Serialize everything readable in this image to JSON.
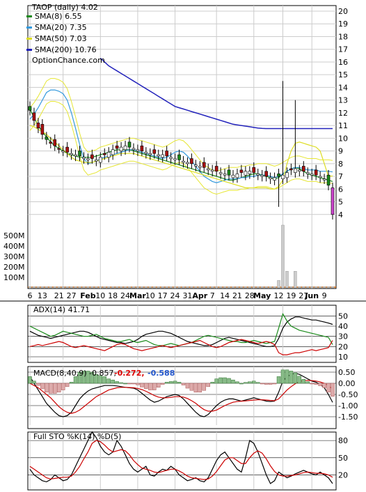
{
  "chart_data": [
    {
      "panel": "price",
      "type": "candlestick",
      "title": "TAOP (daily) 4.02",
      "watermark": "OptionChance.com",
      "legend": [
        {
          "label": "SMA(8) 6.55",
          "color": "#1a8a1a"
        },
        {
          "label": "SMA(20) 7.35",
          "color": "#3399dd"
        },
        {
          "label": "SMA(50) 7.03",
          "color": "#dddd22"
        },
        {
          "label": "SMA(200) 10.76",
          "color": "#2222bb"
        }
      ],
      "legend_position": "top-left",
      "x_tick_labels": [
        "6",
        "13",
        "21",
        "27",
        "Feb",
        "10",
        "18",
        "24",
        "Mar",
        "10",
        "17",
        "24",
        "31",
        "Apr",
        "7",
        "14",
        "21",
        "28",
        "May",
        "12",
        "19",
        "27",
        "Jun",
        "9"
      ],
      "ylim": [
        3,
        20
      ],
      "y_ticks": [
        4,
        5,
        6,
        7,
        8,
        9,
        10,
        11,
        12,
        13,
        14,
        15,
        16,
        17,
        18,
        19,
        20
      ],
      "volume_ticks": [
        "100M",
        "200M",
        "300M",
        "400M",
        "500M"
      ],
      "grid": true,
      "close": [
        12.2,
        11.4,
        10.8,
        10.3,
        9.9,
        9.6,
        9.4,
        9.2,
        9.0,
        8.9,
        8.8,
        8.7,
        8.6,
        8.5,
        8.4,
        8.4,
        8.3,
        8.5,
        8.7,
        8.9,
        9.1,
        9.2,
        9.3,
        9.4,
        9.3,
        9.2,
        9.1,
        9.0,
        8.9,
        8.8,
        8.8,
        8.7,
        8.7,
        8.6,
        8.5,
        8.4,
        8.3,
        8.2,
        8.1,
        8.0,
        7.9,
        7.8,
        7.7,
        7.6,
        7.5,
        7.4,
        7.3,
        7.2,
        7.1,
        7.1,
        7.2,
        7.3,
        7.4,
        7.4,
        7.3,
        7.2,
        7.1,
        7.0,
        6.9,
        6.9,
        7.0,
        7.1,
        7.3,
        7.5,
        7.6,
        7.5,
        7.4,
        7.3,
        7.2,
        7.1,
        7.0,
        6.8,
        6.3,
        4.0
      ],
      "sma": {
        "SMA(8)": [
          12.3,
          11.6,
          11.0,
          10.5,
          10.1,
          9.7,
          9.4,
          9.2,
          9.0,
          8.8,
          8.7,
          8.6,
          8.5,
          8.5,
          8.5,
          8.5,
          8.6,
          8.7,
          8.8,
          8.9,
          9.0,
          9.1,
          9.1,
          9.1,
          9.1,
          9.0,
          8.9,
          8.8,
          8.7,
          8.6,
          8.5,
          8.4,
          8.3,
          8.2,
          8.1,
          8.0,
          7.9,
          7.8,
          7.7,
          7.6,
          7.5,
          7.4,
          7.3,
          7.2,
          7.1,
          7.0,
          6.9,
          6.8,
          6.7,
          6.7,
          6.8,
          6.9,
          7.0,
          7.1,
          7.2,
          7.2,
          7.1,
          7.0,
          6.9,
          6.8,
          6.9,
          7.2,
          7.4,
          7.6,
          7.7,
          7.6,
          7.4,
          7.2,
          7.1,
          7.0,
          6.9,
          6.8,
          6.7,
          6.6
        ],
        "SMA(20)": [
          11.5,
          11.9,
          12.4,
          13.0,
          13.6,
          13.8,
          13.8,
          13.7,
          13.5,
          13.0,
          12.0,
          10.8,
          9.5,
          8.4,
          8.0,
          8.1,
          8.2,
          8.4,
          8.5,
          8.6,
          8.7,
          8.8,
          8.9,
          9.0,
          9.1,
          9.1,
          9.0,
          8.9,
          8.8,
          8.7,
          8.6,
          8.5,
          8.4,
          8.5,
          8.7,
          8.9,
          9.0,
          8.9,
          8.6,
          8.2,
          7.8,
          7.4,
          7.0,
          6.8,
          6.6,
          6.5,
          6.6,
          6.7,
          6.8,
          6.8,
          6.8,
          6.9,
          6.9,
          7.0,
          7.0,
          7.1,
          7.1,
          7.1,
          7.0,
          6.9,
          7.0,
          7.2,
          7.4,
          7.6,
          7.7,
          7.7,
          7.6,
          7.5,
          7.5,
          7.5,
          7.4,
          7.4,
          7.4,
          7.35
        ],
        "SMA(50)": [
          11.0,
          10.9,
          10.7,
          10.5,
          10.3,
          10.0,
          9.7,
          9.4,
          9.1,
          8.8,
          8.5,
          8.3,
          8.2,
          8.1,
          8.1,
          8.1,
          8.2,
          8.3,
          8.4,
          8.5,
          8.6,
          8.7,
          8.8,
          8.8,
          8.8,
          8.8,
          8.7,
          8.6,
          8.5,
          8.4,
          8.3,
          8.2,
          8.1,
          8.0,
          7.9,
          7.8,
          7.7,
          7.6,
          7.5,
          7.4,
          7.3,
          7.2,
          7.1,
          7.0,
          6.9,
          6.8,
          6.7,
          6.6,
          6.5,
          6.4,
          6.3,
          6.2,
          6.1,
          6.1,
          6.1,
          6.1,
          6.1,
          6.1,
          6.0,
          6.0,
          6.2,
          6.7,
          8.0,
          9.0,
          9.6,
          9.7,
          9.6,
          9.5,
          9.4,
          9.3,
          9.0,
          8.0,
          7.0,
          7.03
        ],
        "SMA(200)": [
          null,
          null,
          null,
          null,
          null,
          null,
          null,
          null,
          null,
          null,
          null,
          null,
          null,
          null,
          null,
          null,
          null,
          16.3,
          16.0,
          15.7,
          15.5,
          15.3,
          15.1,
          14.9,
          14.7,
          14.5,
          14.3,
          14.1,
          13.9,
          13.7,
          13.5,
          13.3,
          13.1,
          12.9,
          12.7,
          12.5,
          12.4,
          12.3,
          12.2,
          12.1,
          12.0,
          11.9,
          11.8,
          11.7,
          11.6,
          11.5,
          11.4,
          11.3,
          11.2,
          11.1,
          11.05,
          11.0,
          10.95,
          10.9,
          10.85,
          10.8,
          10.77,
          10.76,
          10.76,
          10.76,
          10.76,
          10.76,
          10.76,
          10.76,
          10.76,
          10.76,
          10.76,
          10.76,
          10.76,
          10.76,
          10.76,
          10.76,
          10.76,
          10.76
        ]
      }
    },
    {
      "panel": "adx",
      "type": "line",
      "label": "ADX(14) 41.71",
      "ylim": [
        10,
        55
      ],
      "y_ticks": [
        10,
        20,
        30,
        40,
        50
      ],
      "series": [
        {
          "name": "ADX(14)",
          "color": "#000000",
          "values": [
            35,
            33,
            31,
            30,
            29,
            28,
            29,
            30,
            31,
            32,
            33,
            34,
            35,
            35,
            34,
            32,
            30,
            28,
            27,
            26,
            25,
            24,
            24,
            23,
            24,
            25,
            27,
            30,
            32,
            33,
            34,
            35,
            35,
            34,
            33,
            31,
            29,
            27,
            25,
            24,
            23,
            22,
            21,
            21,
            22,
            24,
            26,
            28,
            29,
            28,
            27,
            26,
            25,
            24,
            23,
            22,
            21,
            20,
            20,
            21,
            28,
            38,
            44,
            47,
            49,
            49,
            48,
            47,
            46,
            46,
            45,
            44,
            43,
            41.71
          ]
        },
        {
          "name": "+DI",
          "color": "#1a8a1a",
          "values": [
            40,
            38,
            36,
            34,
            32,
            30,
            31,
            33,
            35,
            34,
            33,
            32,
            31,
            30,
            30,
            31,
            32,
            30,
            28,
            27,
            26,
            25,
            25,
            26,
            27,
            25,
            24,
            25,
            26,
            24,
            22,
            21,
            21,
            22,
            23,
            22,
            21,
            22,
            23,
            24,
            26,
            28,
            30,
            31,
            30,
            29,
            28,
            27,
            26,
            25,
            25,
            24,
            24,
            25,
            26,
            25,
            24,
            23,
            24,
            25,
            38,
            52,
            45,
            40,
            38,
            36,
            35,
            34,
            33,
            32,
            31,
            30,
            29,
            22
          ]
        },
        {
          "name": "-DI",
          "color": "#cc0000",
          "values": [
            20,
            21,
            22,
            21,
            22,
            23,
            24,
            25,
            24,
            22,
            20,
            19,
            20,
            21,
            20,
            19,
            18,
            17,
            16,
            18,
            20,
            22,
            23,
            22,
            20,
            18,
            17,
            16,
            17,
            18,
            19,
            20,
            21,
            20,
            19,
            20,
            21,
            22,
            23,
            24,
            25,
            26,
            24,
            22,
            20,
            19,
            20,
            22,
            24,
            25,
            26,
            27,
            26,
            25,
            24,
            23,
            24,
            25,
            24,
            22,
            14,
            12,
            12,
            13,
            14,
            14,
            15,
            16,
            17,
            16,
            17,
            18,
            19,
            26
          ]
        }
      ]
    },
    {
      "panel": "macd",
      "type": "line+histogram",
      "label": "MACD(8,40,9) -0.857,",
      "signal_label": "-0.272,",
      "histogram_label": "-0.588",
      "ylim": [
        -1.75,
        0.5
      ],
      "y_ticks": [
        "-1.50",
        "-1.00",
        "-0.50",
        "0.00",
        "0.50"
      ],
      "series": [
        {
          "name": "MACD(8,40,9)",
          "color": "#000000",
          "values": [
            0.3,
            0.0,
            -0.3,
            -0.6,
            -0.9,
            -1.1,
            -1.3,
            -1.45,
            -1.5,
            -1.45,
            -1.3,
            -1.0,
            -0.7,
            -0.5,
            -0.35,
            -0.25,
            -0.2,
            -0.15,
            -0.1,
            -0.1,
            -0.1,
            -0.12,
            -0.15,
            -0.18,
            -0.2,
            -0.22,
            -0.3,
            -0.45,
            -0.6,
            -0.75,
            -0.85,
            -0.8,
            -0.7,
            -0.6,
            -0.55,
            -0.5,
            -0.55,
            -0.7,
            -0.9,
            -1.1,
            -1.3,
            -1.45,
            -1.5,
            -1.4,
            -1.2,
            -1.0,
            -0.85,
            -0.75,
            -0.7,
            -0.7,
            -0.75,
            -0.8,
            -0.75,
            -0.7,
            -0.65,
            -0.7,
            -0.75,
            -0.8,
            -0.82,
            -0.8,
            -0.4,
            0.1,
            0.3,
            0.4,
            0.45,
            0.4,
            0.3,
            0.2,
            0.1,
            0.05,
            -0.05,
            -0.2,
            -0.5,
            -0.857
          ]
        },
        {
          "name": "Signal",
          "color": "#cc0000",
          "values": [
            0.0,
            -0.1,
            -0.2,
            -0.35,
            -0.5,
            -0.65,
            -0.85,
            -1.05,
            -1.2,
            -1.3,
            -1.35,
            -1.3,
            -1.2,
            -1.05,
            -0.9,
            -0.75,
            -0.6,
            -0.5,
            -0.4,
            -0.3,
            -0.25,
            -0.2,
            -0.18,
            -0.18,
            -0.19,
            -0.2,
            -0.23,
            -0.28,
            -0.36,
            -0.45,
            -0.55,
            -0.62,
            -0.65,
            -0.65,
            -0.63,
            -0.6,
            -0.6,
            -0.62,
            -0.68,
            -0.78,
            -0.9,
            -1.05,
            -1.18,
            -1.25,
            -1.25,
            -1.2,
            -1.1,
            -1.0,
            -0.92,
            -0.85,
            -0.82,
            -0.8,
            -0.79,
            -0.77,
            -0.75,
            -0.74,
            -0.74,
            -0.75,
            -0.77,
            -0.78,
            -0.7,
            -0.5,
            -0.3,
            -0.15,
            -0.02,
            0.08,
            0.12,
            0.13,
            0.12,
            0.1,
            0.06,
            0.0,
            -0.1,
            -0.272
          ]
        }
      ]
    },
    {
      "panel": "stochastic",
      "type": "line",
      "label": "Full STO %K(14) %D(5)",
      "ylim": [
        0,
        85
      ],
      "y_ticks": [
        20,
        50,
        80
      ],
      "series": [
        {
          "name": "%K(14)",
          "color": "#000000",
          "values": [
            30,
            20,
            15,
            10,
            8,
            12,
            20,
            15,
            10,
            12,
            20,
            35,
            50,
            65,
            80,
            95,
            85,
            70,
            60,
            55,
            60,
            80,
            70,
            55,
            40,
            30,
            25,
            30,
            35,
            20,
            18,
            25,
            30,
            28,
            35,
            30,
            20,
            15,
            10,
            12,
            15,
            10,
            8,
            15,
            30,
            45,
            55,
            60,
            50,
            40,
            30,
            25,
            50,
            80,
            75,
            60,
            40,
            20,
            5,
            10,
            25,
            20,
            15,
            18,
            22,
            25,
            28,
            25,
            22,
            20,
            25,
            20,
            15,
            5
          ]
        },
        {
          "name": "%D(5)",
          "color": "#cc0000",
          "values": [
            35,
            30,
            25,
            20,
            15,
            13,
            14,
            15,
            16,
            16,
            18,
            25,
            35,
            48,
            60,
            75,
            80,
            78,
            72,
            65,
            60,
            62,
            64,
            62,
            55,
            45,
            38,
            32,
            30,
            28,
            25,
            24,
            26,
            28,
            30,
            30,
            27,
            23,
            18,
            15,
            14,
            13,
            12,
            13,
            18,
            26,
            36,
            46,
            50,
            50,
            45,
            40,
            40,
            50,
            58,
            62,
            58,
            48,
            36,
            26,
            20,
            18,
            18,
            19,
            20,
            22,
            24,
            25,
            24,
            23,
            23,
            22,
            20,
            16
          ]
        }
      ]
    }
  ]
}
